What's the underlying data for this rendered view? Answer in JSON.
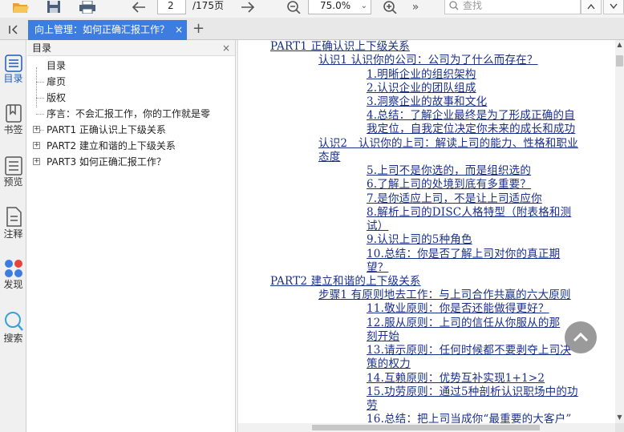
{
  "toolbar": {
    "icons": [
      "folder-open-icon",
      "save-icon",
      "print-icon",
      "arrow-left-icon",
      "arrow-right-icon",
      "zoom-out-icon",
      "zoom-in-icon",
      "more-icon"
    ],
    "current_page": "2",
    "total_pages": "/175页",
    "zoom": "75.0%",
    "search_placeholder": "查找"
  },
  "tabbar": {
    "tab_title": "向上管理：如何正确汇报工作？",
    "tab_close": "×",
    "add": "+",
    "accent_color": "#3d7de0"
  },
  "rail": {
    "items": [
      {
        "label": "目录",
        "icon": "toc-icon"
      },
      {
        "label": "书签",
        "icon": "bookmark-icon"
      },
      {
        "label": "预览",
        "icon": "thumbnail-icon"
      },
      {
        "label": "注释",
        "icon": "annotation-icon"
      },
      {
        "label": "发现",
        "icon": "discover-icon"
      },
      {
        "label": "搜索",
        "icon": "search-icon"
      }
    ]
  },
  "outline": {
    "header": "目录",
    "close": "×",
    "items": [
      {
        "label": "目录",
        "expandable": false
      },
      {
        "label": "扉页",
        "expandable": false
      },
      {
        "label": "版权",
        "expandable": false
      },
      {
        "label": "序言：不会汇报工作，你的工作就是零",
        "expandable": false
      },
      {
        "label": "PART1 正确认识上下级关系",
        "expandable": true
      },
      {
        "label": "PART2 建立和谐的上下级关系",
        "expandable": true
      },
      {
        "label": "PART3 如何正确汇报工作？",
        "expandable": true
      }
    ]
  },
  "document": {
    "lines": [
      "PART1 正确认识上下级关系",
      "认识1 认识你的公司：公司为了什么而存在？",
      "1.明晰企业的组织架构",
      "2.认识企业的团队组成",
      "3.洞察企业的故事和文化",
      "4.总结：了解企业最终是为了形成正确的自",
      "我定位，自我定位决定你未来的成长和成功",
      "认识2　认识你的上司：解读上司的能力、性格和职业",
      "态度",
      "5.上司不是你选的，而是组织选的",
      "6.了解上司的处境到底有多重要？",
      "7.是你适应上司，不是让上司适应你",
      "8.解析上司的DISC人格特型（附表格和测",
      "试）",
      "9.认识上司的5种角色",
      "10.总结：你是否了解上司对你的真正期",
      "望？",
      "PART2 建立和谐的上下级关系",
      "步骤1 有原则地去工作：与上司合作共赢的六大原则",
      "11.敬业原则：你是否还能做得更好？",
      "12.服从原则：上司的信任从你服从的那",
      "刻开始",
      "13.请示原则：任何时候都不要剥夺上司决",
      "策的权力",
      "14.互赖原则：优势互补实现1+1>2",
      "15.功劳原则：通过5种剖析认识职场中的功",
      "劳",
      "16.总结：把上司当成你“最重要的大客户”"
    ]
  }
}
